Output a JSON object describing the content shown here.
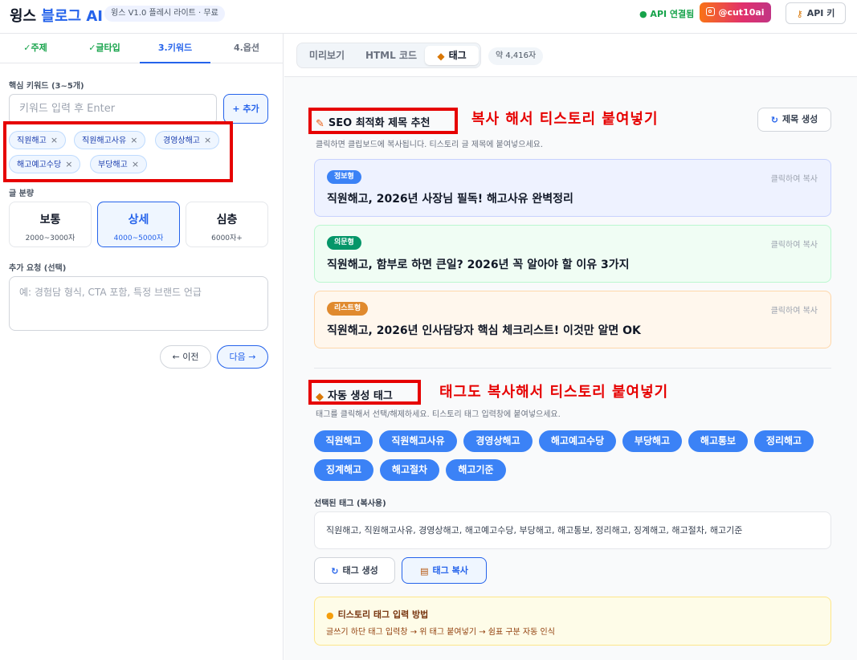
{
  "header": {
    "brand_main": "윙스 ",
    "brand_accent": "블로그 AI",
    "version": "윙스 V1.0 플레시 라이트 · 무료",
    "api_status": "● API 연결됨",
    "instagram": "@cut10ai",
    "api_key": "API 키"
  },
  "left": {
    "steps": [
      "✓주제",
      "✓글타입",
      "3.키워드",
      "4.옵션"
    ],
    "keyword_label": "핵심 키워드 (3~5개)",
    "keyword_placeholder": "키워드 입력 후 Enter",
    "add_button": "+ 추가",
    "keywords": [
      "직원해고",
      "직원해고사유",
      "경영상해고",
      "해고예고수당",
      "부당해고"
    ],
    "chip_remove": "×",
    "volume_label": "글 분량",
    "volumes": [
      {
        "title": "보통",
        "sub": "2000~3000자"
      },
      {
        "title": "상세",
        "sub": "4000~5000자"
      },
      {
        "title": "심층",
        "sub": "6000자+"
      }
    ],
    "extra_label": "추가 요청 (선택)",
    "extra_placeholder": "예: 경험담 형식, CTA 포함, 특정 브랜드 언급",
    "prev_button": "← 이전",
    "next_button": "다음 →"
  },
  "right": {
    "tabs": [
      "미리보기",
      "HTML 코드",
      "태그"
    ],
    "char_count": "약 4,416자",
    "seo_title": "SEO 최적화 제목 추천",
    "seo_annotation": "복사 해서 티스토리 붙여넣기",
    "seo_sub": "클릭하면 클립보드에 복사됩니다. 티스토리 글 제목에 붙여넣으세요.",
    "gen_title_button": "제목 생성",
    "copy_hint": "클릭하여 복사",
    "suggestions": [
      {
        "badge": "정보형",
        "text": "직원해고, 2026년 사장님 필독! 해고사유 완벽정리",
        "color": "#3b82f6"
      },
      {
        "badge": "의문형",
        "text": "직원해고, 함부로 하면 큰일? 2026년 꼭 알아야 할 이유 3가지",
        "color": "#16a34a"
      },
      {
        "badge": "리스트형",
        "text": "직원해고, 2026년 인사담당자 핵심 체크리스트! 이것만 알면 OK",
        "color": "#f59e0b"
      }
    ],
    "tags_title": "자동 생성 태그",
    "tags_annotation": "태그도 복사해서 티스토리 붙여넣기",
    "tags_sub": "태그를 클릭해서 선택/해제하세요. 티스토리 태그 입력창에 붙여넣으세요.",
    "tags": [
      "직원해고",
      "직원해고사유",
      "경영상해고",
      "해고예고수당",
      "부당해고",
      "해고통보",
      "정리해고",
      "징계해고",
      "해고절차",
      "해고기준"
    ],
    "selected_label": "선택된 태그 (복사용)",
    "selected_tags": "직원해고, 직원해고사유, 경영상해고, 해고예고수당, 부당해고, 해고통보, 정리해고, 징계해고, 해고절차, 해고기준",
    "tag_gen_button": "태그 생성",
    "tag_copy_button": "태그 복사",
    "tip_title": "티스토리 태그 입력 방법",
    "tip_desc": "글쓰기 하단 태그 입력창 → 위 태그 붙여넣기 → 쉼표 구분 자동 인식"
  },
  "colors": {
    "accent": "#2563eb",
    "annotation_red": "#e60000",
    "tag_blue": "#3b82f6"
  }
}
